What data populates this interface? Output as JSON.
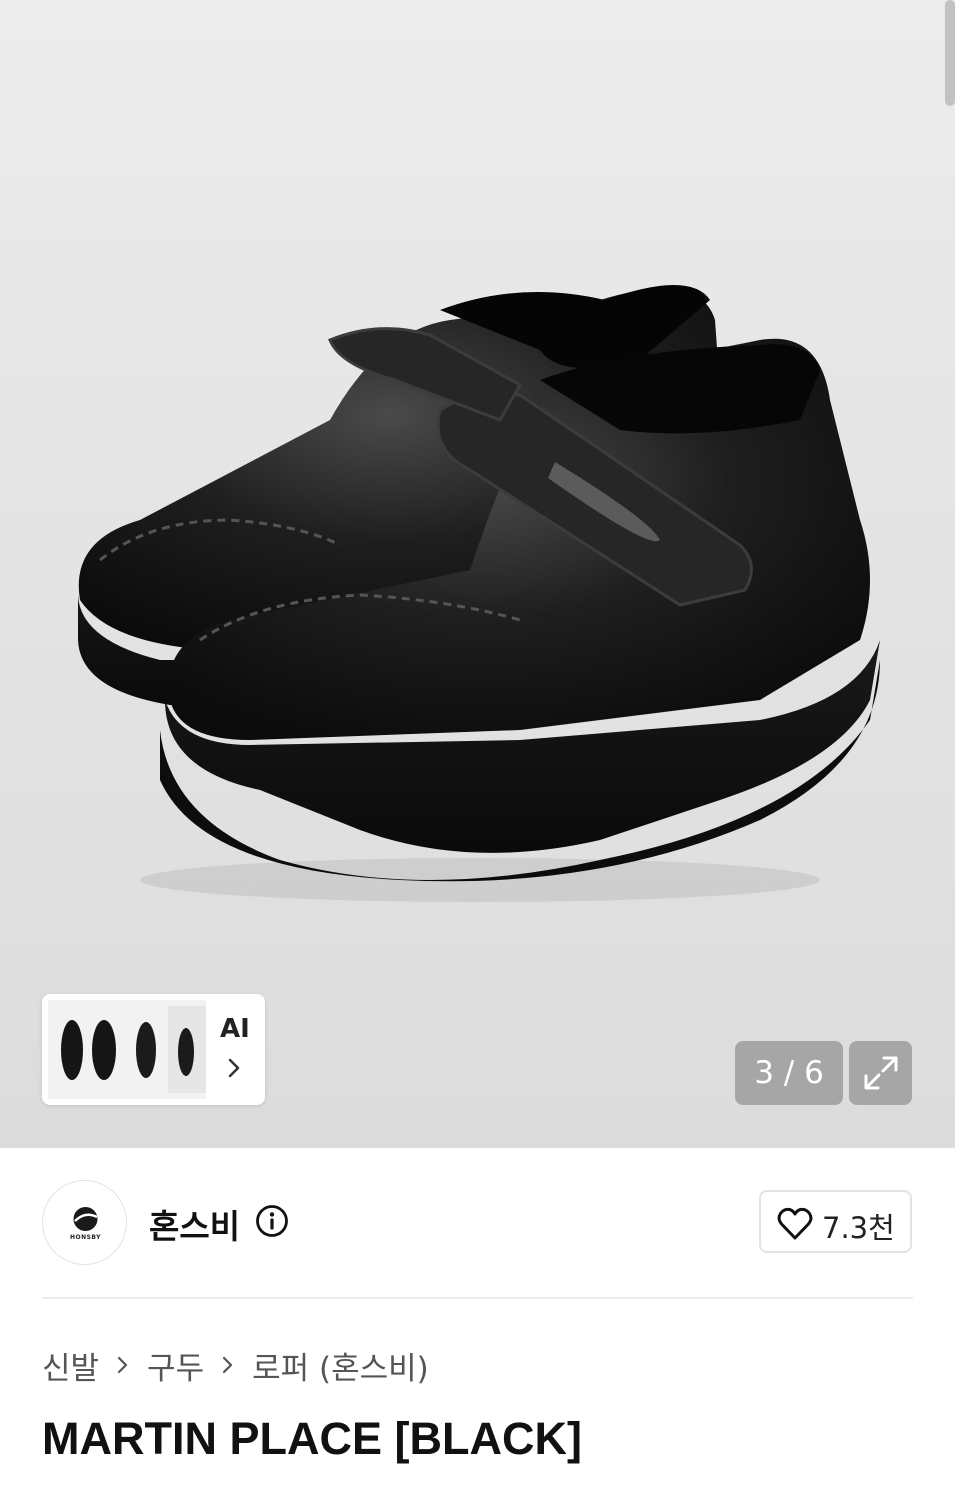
{
  "gallery": {
    "image_alt": "Black leather velcro moccasin loafers on chunky sole",
    "counter": "3 / 6",
    "ai_label": "AI",
    "icons": {
      "expand": "expand-arrows-icon",
      "chevron": "chevron-right-icon"
    }
  },
  "brand": {
    "logo_text": "HONSBY",
    "name": "혼스비",
    "info_icon": "info-icon"
  },
  "like": {
    "count": "7.3천",
    "icon": "heart-outline-icon"
  },
  "breadcrumb": [
    {
      "label": "신발"
    },
    {
      "label": "구두"
    },
    {
      "label": "로퍼 (혼스비)"
    }
  ],
  "product": {
    "title": "MARTIN PLACE [BLACK]"
  },
  "colors": {
    "gallery_bg": "#e4e4e4",
    "badge_bg": "#8a8a8a",
    "text_primary": "#111111",
    "text_secondary": "#555555",
    "border": "#e3e3e3"
  }
}
